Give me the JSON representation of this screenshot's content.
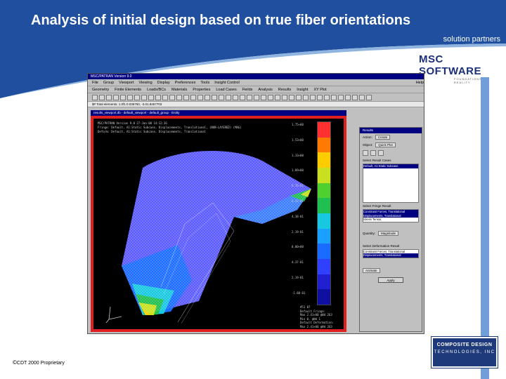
{
  "slide": {
    "title": "Analysis of initial design based on true fiber orientations",
    "subtitle": "solution partners",
    "footer": "CDT 2000 Proprietary",
    "copyright_symbol": "©"
  },
  "colors": {
    "header_blue": "#1f4f9e",
    "accent_bar": "#6f9fd6",
    "cdt_navy": "#1e3a7a",
    "msc_navy": "#1a2f7a"
  },
  "logos": {
    "msc": {
      "brand": "MSC SOFTWARE",
      "tagline": "FOUNDATIONS OF REALITY"
    },
    "cdt": {
      "line1": "COMPOSITE DESIGN",
      "line2": "TECHNOLOGIES, INC"
    }
  },
  "app": {
    "window_title": "MSC/PATRAN Version 9.0",
    "menu": [
      "File",
      "Group",
      "Viewport",
      "Viewing",
      "Display",
      "Preferences",
      "Tools",
      "Insight Control"
    ],
    "help": "Help",
    "menu2": [
      "Geometry",
      "Finite Elements",
      "Loads/BCs",
      "Materials",
      "Properties",
      "Load Cases",
      "Fields",
      "Analysis",
      "Results",
      "Insight",
      "XY Plot"
    ],
    "command_line": "$# Total elements: 1.0f1.0.036750, -3.01.8457703",
    "viewport_title": "results_viewport.db - default_viewport - default_group - Entity",
    "viewport_header": [
      "MSC/PATRAN Version 9.0 27-Jan-00 14:12:36",
      "Fringe: Default, A1:Static Subcase, Displacements, Translational, (NON-LAYERED) (MAG)",
      "Deform: Default, A1:Static Subcase, Displacements, Translational"
    ],
    "legend_labels": [
      "1.75+00",
      "1.53+00",
      "1.33+00",
      "1.09+00",
      "8.76-01",
      "6.55-01",
      "4.38-01",
      "2.19-01",
      "0.00+00",
      "4.37-01",
      "2.19-01",
      "-1.88-01"
    ],
    "viewport_footer": [
      "#51 07",
      "Default Fringe:",
      "Max 2.41+00 @Nd 263",
      "Min 0. @Nd 1",
      "Default Deformation:",
      "Max 2.41+00 @Nd 263"
    ],
    "results_panel": {
      "title": "Results",
      "action_label": "Action:",
      "action_value": "Create",
      "object_label": "Object:",
      "object_value": "Quick Plot",
      "select_cases_label": "Select Result Cases",
      "result_case": "Default, A1:Static Subcase",
      "fringe_label": "Select Fringe Result",
      "fringe_items": [
        "Constraint Forces, Translational",
        "Displacements, Translational",
        "Stress Tensor,"
      ],
      "quantity_label": "Quantity:",
      "quantity_value": "Magnitude",
      "deformation_label": "Select Deformation Result",
      "deformation_items": [
        "Constraint Forces, Translational",
        "Displacements, Translational"
      ],
      "animate_label": "Animate",
      "apply_label": "Apply"
    }
  }
}
